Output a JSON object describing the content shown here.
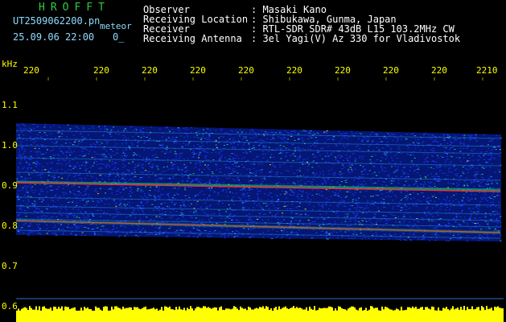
{
  "app": {
    "title": "HROFFT"
  },
  "file": {
    "name": "UT2509062200.pn",
    "mode": "meteor",
    "datetime": "25.09.06 22:00",
    "counter": "0_"
  },
  "station": {
    "observer_label": "Observer",
    "observer_value": ": Masaki Kano",
    "location_label": "Receiving Location",
    "location_value": ": Shibukawa, Gunma, Japan",
    "receiver_label": "Receiver",
    "receiver_value": ": RTL-SDR SDR# 43dB L15 103.2MHz CW",
    "antenna_label": "Receiving Antenna",
    "antenna_value": ": 3el Yagi(V) Az 330 for Vladivostok"
  },
  "axis": {
    "unit": "kHz",
    "time_ticks": [
      "220",
      "220",
      "220",
      "220",
      "220",
      "220",
      "220",
      "220",
      "220",
      "2210"
    ],
    "freq_ticks": [
      "1.1",
      "1.0",
      "0.9",
      "0.8",
      "0.7",
      "0.6"
    ]
  },
  "colors": {
    "background": "#000000",
    "title_green": "#2ecc40",
    "header_cyan": "#8fdcff",
    "axis_yellow": "#ffff00",
    "signal_red": "#ff3030",
    "noise_blue": "#1a3cff",
    "noise_green": "#20e060",
    "baseline_yellow": "#ffff00"
  }
}
